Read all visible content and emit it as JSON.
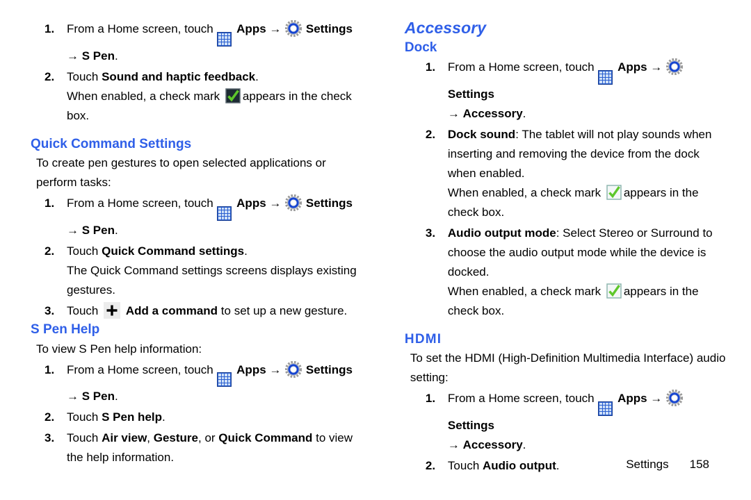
{
  "meta": {
    "accent_heading_color": "#2f5fe8",
    "body_text_color": "#000000"
  },
  "icons": {
    "apps": "apps-grid-icon",
    "settings": "settings-gear-icon",
    "check_dark": "checkbox-checked-dark-icon",
    "check_light": "checkbox-checked-light-icon",
    "plus": "plus-add-icon",
    "arrow": "→"
  },
  "left_column": {
    "top_steps": [
      {
        "num": "1.",
        "text_before_apps": "From a Home screen, touch ",
        "apps_label": "Apps",
        "settings_label": "Settings",
        "trailing_arrow_target": "S Pen",
        "trailing_period": "."
      },
      {
        "num": "2.",
        "text_before": "Touch ",
        "bold_text": "Sound and haptic feedback",
        "text_after": ".",
        "note_before_check": "When enabled, a check mark ",
        "note_after_check": "appears in the check box."
      }
    ],
    "quick_command_settings": {
      "heading": "Quick Command Settings",
      "intro": "To create pen gestures to open selected applications or perform tasks:",
      "steps": [
        {
          "num": "1.",
          "text_before_apps": "From a Home screen, touch ",
          "apps_label": "Apps",
          "settings_label": "Settings",
          "trailing_arrow_target": "S Pen",
          "trailing_period": "."
        },
        {
          "num": "2.",
          "text_before": "Touch ",
          "bold_text": "Quick Command settings",
          "text_after": ".",
          "note": "The Quick Command settings screens displays existing gestures."
        },
        {
          "num": "3.",
          "text_before": "Touch ",
          "bold_text": "Add a command",
          "text_after": " to set up a new gesture."
        }
      ]
    },
    "s_pen_help": {
      "heading": "S Pen Help",
      "intro": "To view S Pen help information:",
      "steps": [
        {
          "num": "1.",
          "text_before_apps": "From a Home screen, touch ",
          "apps_label": "Apps",
          "settings_label": "Settings",
          "trailing_arrow_target": "S Pen",
          "trailing_period": "."
        },
        {
          "num": "2.",
          "text_before": "Touch ",
          "bold_text": "S Pen help",
          "text_after": "."
        },
        {
          "num": "3.",
          "text_before": "Touch ",
          "bold_a": "Air view",
          "sep_a": ", ",
          "bold_b": "Gesture",
          "sep_b": ", or ",
          "bold_c": "Quick Command",
          "text_after": " to view the help information."
        }
      ]
    }
  },
  "right_column": {
    "chapter_heading": "Accessory",
    "dock": {
      "heading": "Dock",
      "steps": [
        {
          "num": "1.",
          "text_before_apps": "From a Home screen, touch ",
          "apps_label": "Apps",
          "settings_label": "Settings",
          "trailing_arrow_target": "Accessory",
          "trailing_period": "."
        },
        {
          "num": "2.",
          "bold_text": "Dock sound",
          "text_after": ": The tablet will not play sounds when inserting and removing the device from the dock when enabled.",
          "note_before_check": "When enabled, a check mark ",
          "note_after_check": "appears in the check box."
        },
        {
          "num": "3.",
          "bold_text": "Audio output mode",
          "text_after": ": Select Stereo or Surround to choose the audio output mode while the device is docked.",
          "note_before_check": "When enabled, a check mark ",
          "note_after_check": "appears in the check box."
        }
      ]
    },
    "hdmi": {
      "heading": "HDMI",
      "intro": "To set the HDMI (High-Definition Multimedia Interface) audio setting:",
      "steps": [
        {
          "num": "1.",
          "text_before_apps": "From a Home screen, touch ",
          "apps_label": "Apps",
          "settings_label": "Settings",
          "trailing_arrow_target": "Accessory",
          "trailing_period": "."
        },
        {
          "num": "2.",
          "text_before": "Touch ",
          "bold_text": "Audio output",
          "text_after": "."
        }
      ]
    }
  },
  "footer": {
    "section": "Settings",
    "page_number": "158"
  }
}
